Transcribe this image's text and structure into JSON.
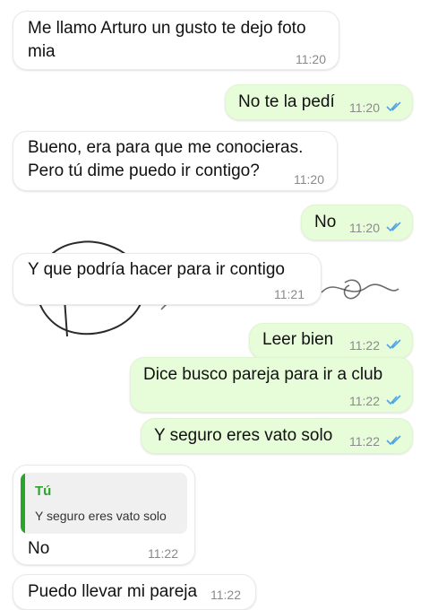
{
  "colors": {
    "out_bubble": "#e7fcd9",
    "in_bubble": "#ffffff",
    "read_ticks": "#4fa3e0",
    "quote_accent": "#2aa52a"
  },
  "messages": [
    {
      "dir": "in",
      "lines": [
        "Me llamo Arturo un gusto te dejo foto",
        "mia"
      ],
      "time": "11:20"
    },
    {
      "dir": "out",
      "lines": [
        "No te la pedí"
      ],
      "time": "11:20",
      "ticks": "read-ticks-icon"
    },
    {
      "dir": "in",
      "lines": [
        "Bueno, era para que me conocieras.",
        "Pero tú dime puedo ir contigo?"
      ],
      "time": "11:20"
    },
    {
      "dir": "out",
      "lines": [
        "No"
      ],
      "time": "11:20",
      "ticks": "read-ticks-icon"
    },
    {
      "dir": "in",
      "lines": [
        "Y que podría hacer para ir contigo"
      ],
      "time": "11:21"
    },
    {
      "dir": "out",
      "lines": [
        "Leer bien"
      ],
      "time": "11:22",
      "ticks": "read-ticks-icon"
    },
    {
      "dir": "out",
      "lines": [
        "Dice busco pareja para ir a club"
      ],
      "time": "11:22",
      "ticks": "read-ticks-icon"
    },
    {
      "dir": "out",
      "lines": [
        "Y seguro eres vato solo"
      ],
      "time": "11:22",
      "ticks": "read-ticks-icon"
    },
    {
      "dir": "in",
      "quote": {
        "author": "Tú",
        "text": "Y seguro eres vato solo"
      },
      "lines": [
        "No"
      ],
      "time": "11:22"
    },
    {
      "dir": "in",
      "lines": [
        "Puedo llevar mi pareja"
      ],
      "time": "11:22"
    }
  ]
}
